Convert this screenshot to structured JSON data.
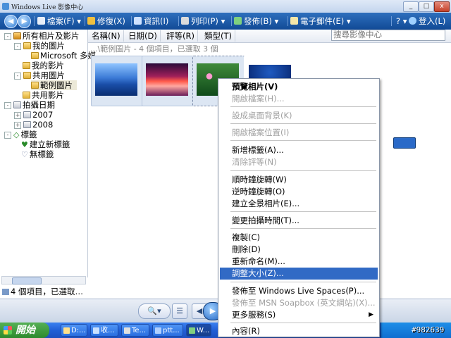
{
  "window": {
    "title": "Windows Live 影像中心"
  },
  "toolbar": {
    "file": "檔案(F)",
    "fix": "修復(X)",
    "info": "資訊(I)",
    "print": "列印(P)",
    "publish": "發佈(B)",
    "email": "電子郵件(E)",
    "signin": "登入(L)"
  },
  "columns": [
    "名稱(N)",
    "日期(D)",
    "評等(R)",
    "類型(T)"
  ],
  "search": {
    "placeholder": "搜尋影像中心"
  },
  "breadcrumb": "...\\範例圖片 - 4 個項目，已選取 3 個",
  "sidebar": {
    "items": [
      "所有相片及影片",
      "我的圖片",
      "Microsoft 多媒",
      "我的影片",
      "共用圖片",
      "範例圖片",
      "共用影片",
      "拍攝日期",
      "2007",
      "2008",
      "標籤",
      "建立新標籤",
      "無標籤"
    ]
  },
  "status": "4 個項目，已選取…",
  "context_menu": {
    "items": [
      "預覽相片(V)",
      "開啟檔案(H)...",
      "設成桌面背景(K)",
      "開啟檔案位置(I)",
      "新增標籤(A)...",
      "清除評等(N)",
      "順時鐘旋轉(W)",
      "逆時鐘旋轉(O)",
      "建立全景相片(E)...",
      "變更拍攝時間(T)...",
      "複製(C)",
      "刪除(D)",
      "重新命名(M)...",
      "調整大小(Z)...",
      "發佈至 Windows Live Spaces(P)...",
      "發佈至 MSN Soapbox (英文網站)(X)...",
      "更多服務(S)",
      "內容(R)"
    ],
    "highlighted": "調整大小(Z)..."
  },
  "taskbar": {
    "start": "開始",
    "buttons": [
      "D:...",
      "收...",
      "Te...",
      "ptt...",
      "W..."
    ]
  },
  "watermark": "#982639",
  "colors": {
    "toolbar": "#1f5aa8",
    "highlight": "#316ac5",
    "taskbar": "#245edb"
  }
}
